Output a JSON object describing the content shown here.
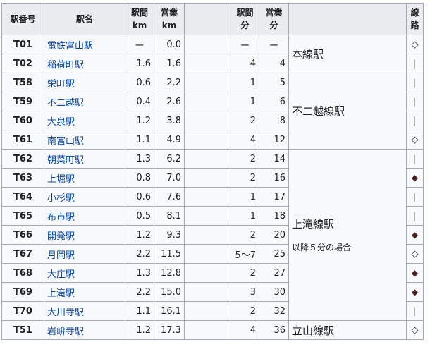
{
  "headers": {
    "code": "駅番号",
    "name": "駅名",
    "dist_between_l1": "駅間",
    "dist_between_l2": "km",
    "dist_total_l1": "営業",
    "dist_total_l2": "km",
    "time_between_l1": "駅間",
    "time_between_l2": "分",
    "time_total_l1": "営業",
    "time_total_l2": "分",
    "line_l1": "線",
    "line_l2": "路"
  },
  "stations": [
    {
      "code": "T01",
      "name": "電鉄富山駅",
      "dist": "ー",
      "total": "0.0",
      "time": "ー",
      "ttotal": "ー",
      "sym": "◇",
      "symtype": "diamond"
    },
    {
      "code": "T02",
      "name": "稲荷町駅",
      "dist": "1.6",
      "total": "1.6",
      "time": "4",
      "ttotal": "4",
      "sym": "｜",
      "symtype": "bar"
    },
    {
      "code": "T58",
      "name": "栄町駅",
      "dist": "0.6",
      "total": "2.2",
      "time": "1",
      "ttotal": "5",
      "sym": "｜",
      "symtype": "bar"
    },
    {
      "code": "T59",
      "name": "不二越駅",
      "dist": "0.4",
      "total": "2.6",
      "time": "1",
      "ttotal": "6",
      "sym": "｜",
      "symtype": "bar"
    },
    {
      "code": "T60",
      "name": "大泉駅",
      "dist": "1.2",
      "total": "3.8",
      "time": "2",
      "ttotal": "8",
      "sym": "｜",
      "symtype": "bar"
    },
    {
      "code": "T61",
      "name": "南富山駅",
      "dist": "1.1",
      "total": "4.9",
      "time": "4",
      "ttotal": "12",
      "sym": "◇",
      "symtype": "diamond"
    },
    {
      "code": "T62",
      "name": "朝菜町駅",
      "dist": "1.3",
      "total": "6.2",
      "time": "2",
      "ttotal": "14",
      "sym": "｜",
      "symtype": "bar"
    },
    {
      "code": "T63",
      "name": "上堀駅",
      "dist": "0.8",
      "total": "7.0",
      "time": "2",
      "ttotal": "16",
      "sym": "◆",
      "symtype": "solid"
    },
    {
      "code": "T64",
      "name": "小杉駅",
      "dist": "0.6",
      "total": "7.6",
      "time": "1",
      "ttotal": "17",
      "sym": "｜",
      "symtype": "bar"
    },
    {
      "code": "T65",
      "name": "布市駅",
      "dist": "0.5",
      "total": "8.1",
      "time": "1",
      "ttotal": "18",
      "sym": "｜",
      "symtype": "bar"
    },
    {
      "code": "T66",
      "name": "開発駅",
      "dist": "1.2",
      "total": "9.3",
      "time": "2",
      "ttotal": "20",
      "sym": "◆",
      "symtype": "solid"
    },
    {
      "code": "T67",
      "name": "月岡駅",
      "dist": "2.2",
      "total": "11.5",
      "time": "5～7",
      "ttotal": "25",
      "sym": "◇",
      "symtype": "diamond"
    },
    {
      "code": "T68",
      "name": "大庄駅",
      "dist": "1.3",
      "total": "12.8",
      "time": "2",
      "ttotal": "27",
      "sym": "◆",
      "symtype": "solid"
    },
    {
      "code": "T69",
      "name": "上滝駅",
      "dist": "2.2",
      "total": "15.0",
      "time": "3",
      "ttotal": "30",
      "sym": "◆",
      "symtype": "solid"
    },
    {
      "code": "T70",
      "name": "大川寺駅",
      "dist": "1.1",
      "total": "16.1",
      "time": "2",
      "ttotal": "32",
      "sym": "｜",
      "symtype": "bar"
    },
    {
      "code": "T51",
      "name": "岩峅寺駅",
      "dist": "1.2",
      "total": "17.3",
      "time": "4",
      "ttotal": "36",
      "sym": "◇",
      "symtype": "diamond"
    }
  ],
  "notes": {
    "honsen": "本線駅",
    "fujikoshi": "不二越線駅",
    "kamidaki": "上滝線駅",
    "kamidaki_sub": "以降５分の場合",
    "tateyama": "立山線駅"
  }
}
